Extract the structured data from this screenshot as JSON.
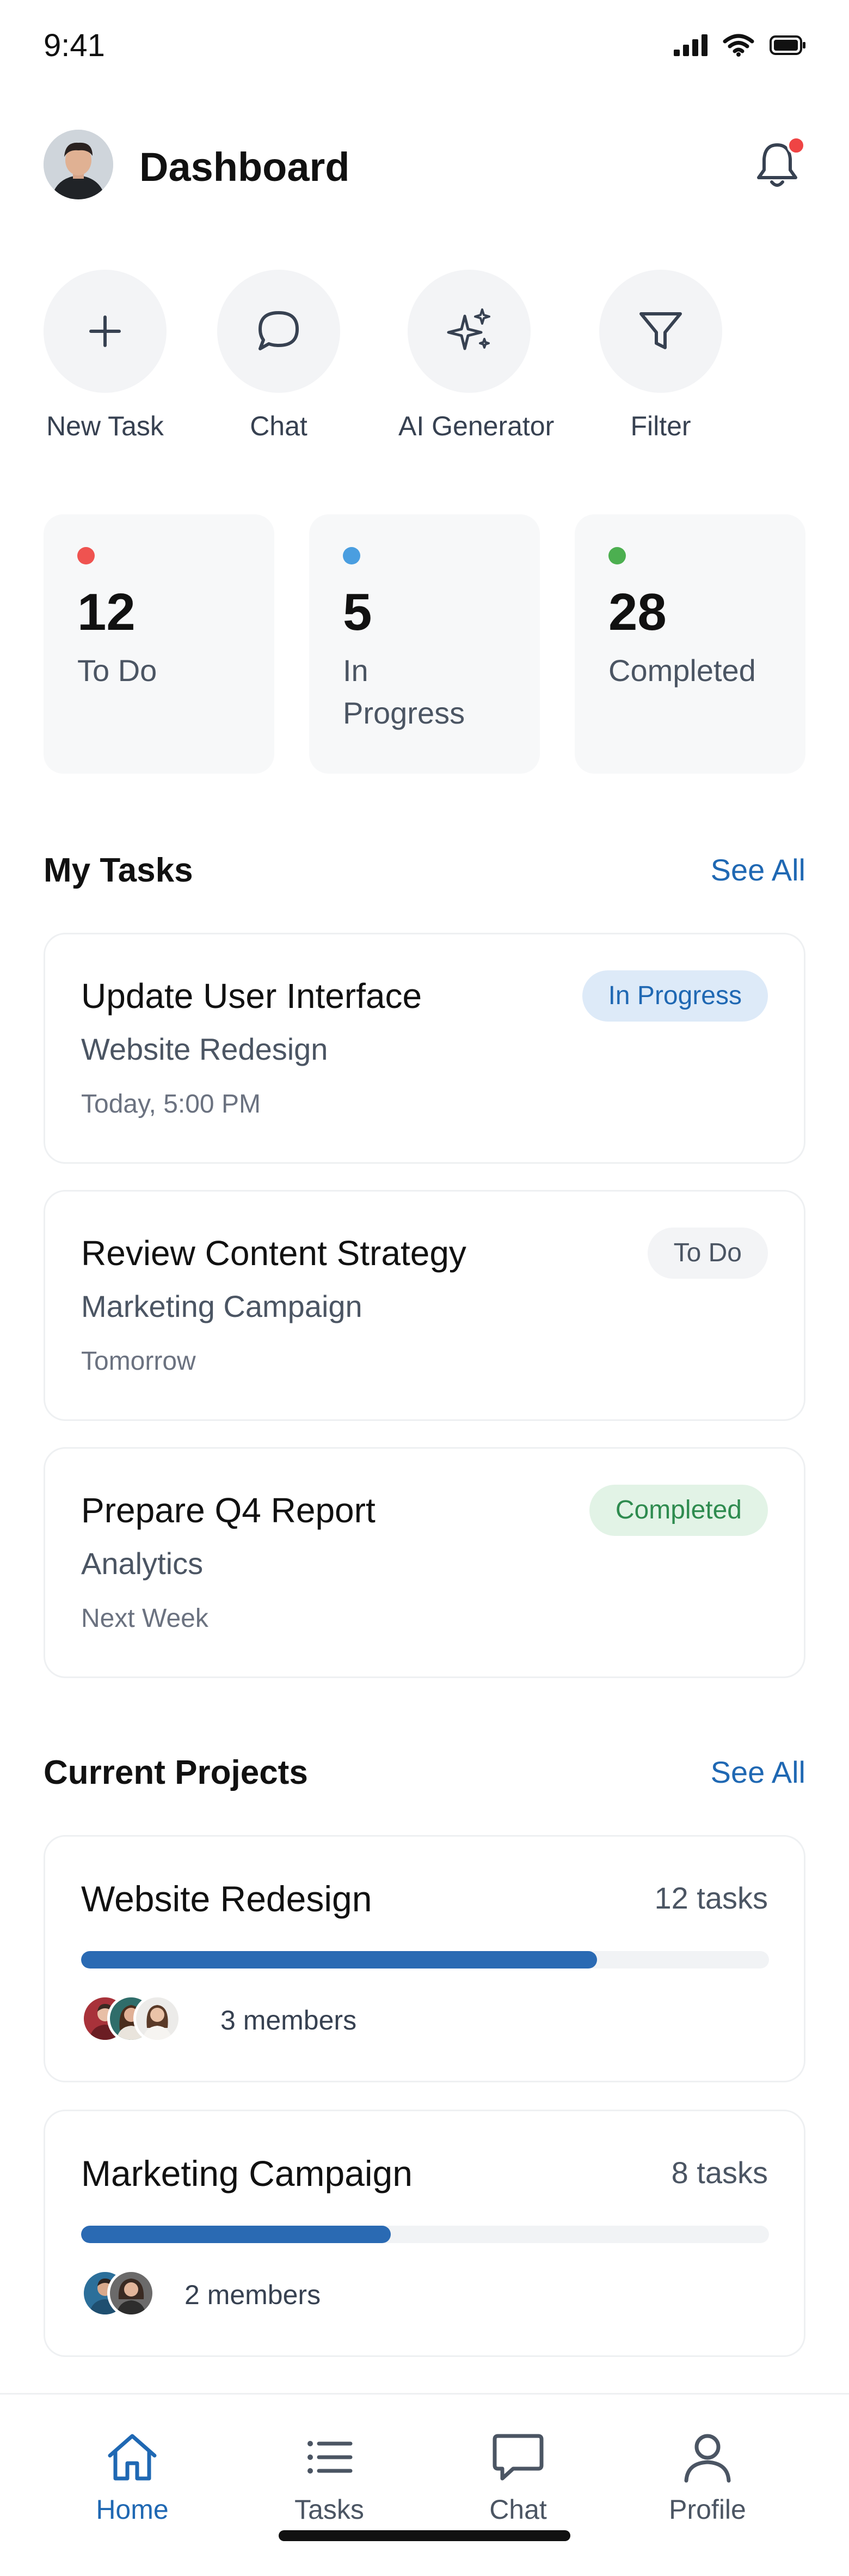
{
  "status_bar": {
    "time": "9:41"
  },
  "header": {
    "title": "Dashboard",
    "notification_dot_color": "#ef4444"
  },
  "quick_actions": [
    {
      "label": "New Task",
      "icon": "plus-icon"
    },
    {
      "label": "Chat",
      "icon": "chat-bubble-icon"
    },
    {
      "label": "AI Generator",
      "icon": "sparkles-icon"
    },
    {
      "label": "Filter",
      "icon": "filter-icon"
    }
  ],
  "stats": [
    {
      "value": "12",
      "label": "To Do",
      "dot_color": "#ef5350"
    },
    {
      "value": "5",
      "label": "In Progress",
      "dot_color": "#4a9ee0"
    },
    {
      "value": "28",
      "label": "Completed",
      "dot_color": "#4caf50"
    }
  ],
  "tasks_section": {
    "title": "My Tasks",
    "see_all": "See All"
  },
  "tasks": [
    {
      "title": "Update User Interface",
      "project": "Website Redesign",
      "due": "Today, 5:00 PM",
      "status": "In Progress",
      "badge_bg": "#ddeaf8",
      "badge_fg": "#1f68b3"
    },
    {
      "title": "Review Content Strategy",
      "project": "Marketing Campaign",
      "due": "Tomorrow",
      "status": "To Do",
      "badge_bg": "#f3f4f6",
      "badge_fg": "#4b5563"
    },
    {
      "title": "Prepare Q4 Report",
      "project": "Analytics",
      "due": "Next Week",
      "status": "Completed",
      "badge_bg": "#e2f3e6",
      "badge_fg": "#2e8b4f"
    }
  ],
  "projects_section": {
    "title": "Current Projects",
    "see_all": "See All"
  },
  "projects": [
    {
      "name": "Website Redesign",
      "task_count": "12 tasks",
      "progress": 0.75,
      "members_label": "3 members",
      "member_count": 3
    },
    {
      "name": "Marketing Campaign",
      "task_count": "8 tasks",
      "progress": 0.45,
      "members_label": "2 members",
      "member_count": 2
    }
  ],
  "bottom_nav": [
    {
      "label": "Home",
      "icon": "home-icon",
      "active": true
    },
    {
      "label": "Tasks",
      "icon": "list-icon",
      "active": false
    },
    {
      "label": "Chat",
      "icon": "chat-icon",
      "active": false
    },
    {
      "label": "Profile",
      "icon": "profile-icon",
      "active": false
    }
  ],
  "colors": {
    "accent": "#1f68b3",
    "progress": "#2a6ab3"
  }
}
